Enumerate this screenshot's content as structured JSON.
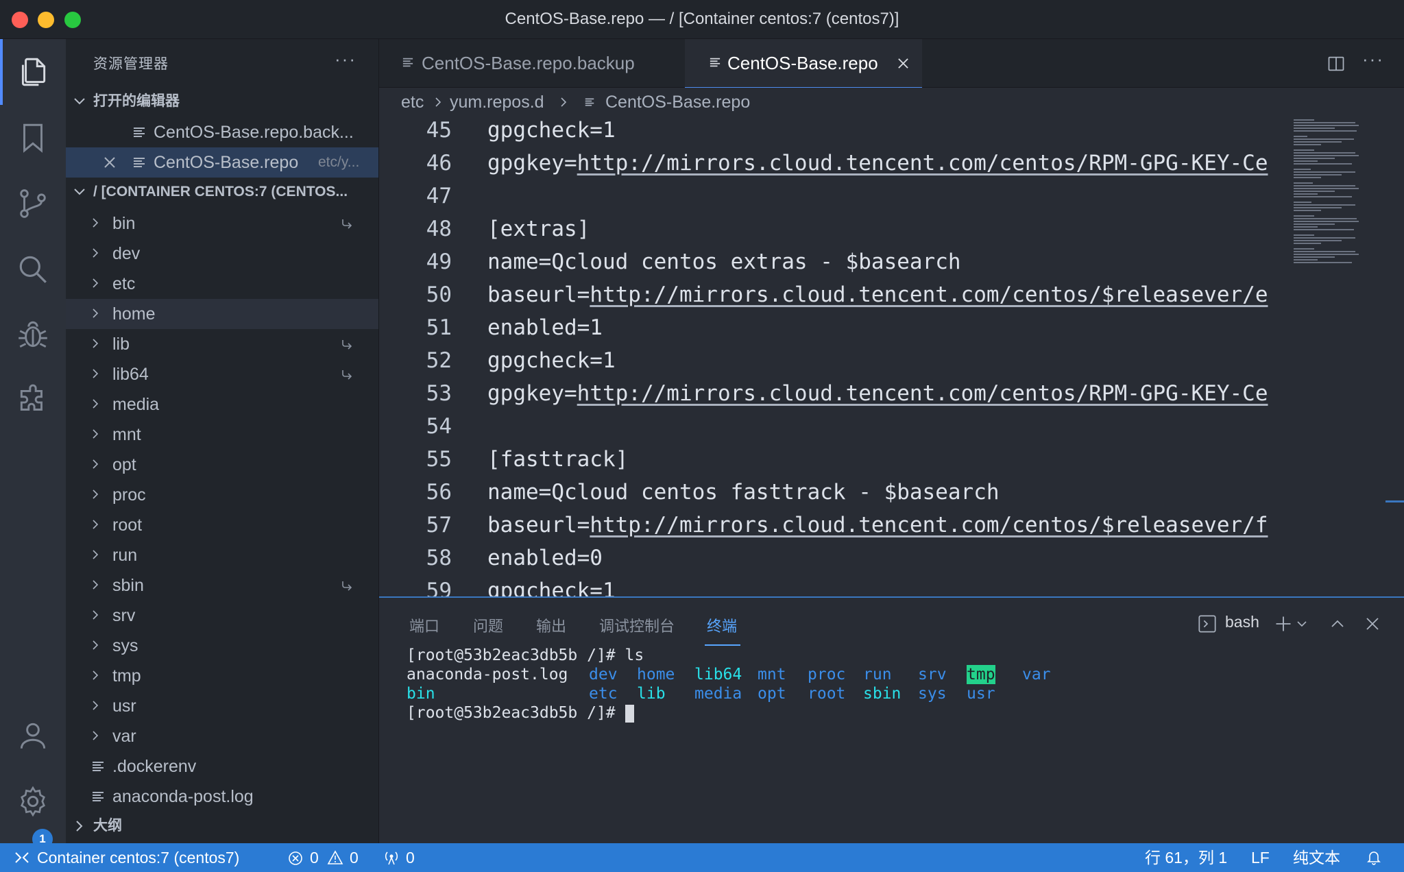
{
  "window": {
    "title": "CentOS-Base.repo — / [Container centos:7 (centos7)]",
    "traffic_colors": {
      "close": "#ff5f57",
      "minimize": "#febc2e",
      "zoom": "#28c840"
    }
  },
  "activity_bar": {
    "items": [
      "explorer-icon",
      "bookmark-icon",
      "source-control-icon",
      "search-icon",
      "debug-icon",
      "extensions-icon"
    ],
    "bottom": [
      "account-icon",
      "settings-icon"
    ],
    "settings_badge": "1"
  },
  "sidebar": {
    "title": "资源管理器",
    "more": "···",
    "open_editors": {
      "header": "打开的编辑器",
      "items": [
        {
          "name": "CentOS-Base.repo.back...",
          "path": ""
        },
        {
          "name": "CentOS-Base.repo",
          "path": "etc/y..."
        }
      ]
    },
    "root": {
      "header": "/ [CONTAINER CENTOS:7 (CENTOS...",
      "folders": [
        {
          "name": "bin",
          "symlink": true
        },
        {
          "name": "dev",
          "symlink": false
        },
        {
          "name": "etc",
          "symlink": false
        },
        {
          "name": "home",
          "symlink": false
        },
        {
          "name": "lib",
          "symlink": true
        },
        {
          "name": "lib64",
          "symlink": true
        },
        {
          "name": "media",
          "symlink": false
        },
        {
          "name": "mnt",
          "symlink": false
        },
        {
          "name": "opt",
          "symlink": false
        },
        {
          "name": "proc",
          "symlink": false
        },
        {
          "name": "root",
          "symlink": false
        },
        {
          "name": "run",
          "symlink": false
        },
        {
          "name": "sbin",
          "symlink": true
        },
        {
          "name": "srv",
          "symlink": false
        },
        {
          "name": "sys",
          "symlink": false
        },
        {
          "name": "tmp",
          "symlink": false
        },
        {
          "name": "usr",
          "symlink": false
        },
        {
          "name": "var",
          "symlink": false
        }
      ],
      "files": [
        ".dockerenv",
        "anaconda-post.log"
      ]
    },
    "outline_header": "大纲"
  },
  "editor": {
    "tabs": [
      {
        "label": "CentOS-Base.repo.backup",
        "active": false
      },
      {
        "label": "CentOS-Base.repo",
        "active": true
      }
    ],
    "breadcrumb": [
      "etc",
      "yum.repos.d",
      "CentOS-Base.repo"
    ],
    "lines": [
      {
        "n": "45",
        "pre": "gpgcheck=1",
        "url": ""
      },
      {
        "n": "46",
        "pre": "gpgkey=",
        "url": "http://mirrors.cloud.tencent.com/centos/RPM-GPG-KEY-Ce"
      },
      {
        "n": "47",
        "pre": "",
        "url": ""
      },
      {
        "n": "48",
        "pre": "[extras]",
        "url": ""
      },
      {
        "n": "49",
        "pre": "name=Qcloud centos extras - $basearch",
        "url": ""
      },
      {
        "n": "50",
        "pre": "baseurl=",
        "url": "http://mirrors.cloud.tencent.com/centos/$releasever/e"
      },
      {
        "n": "51",
        "pre": "enabled=1",
        "url": ""
      },
      {
        "n": "52",
        "pre": "gpgcheck=1",
        "url": ""
      },
      {
        "n": "53",
        "pre": "gpgkey=",
        "url": "http://mirrors.cloud.tencent.com/centos/RPM-GPG-KEY-Ce"
      },
      {
        "n": "54",
        "pre": "",
        "url": ""
      },
      {
        "n": "55",
        "pre": "[fasttrack]",
        "url": ""
      },
      {
        "n": "56",
        "pre": "name=Qcloud centos fasttrack - $basearch",
        "url": ""
      },
      {
        "n": "57",
        "pre": "baseurl=",
        "url": "http://mirrors.cloud.tencent.com/centos/$releasever/f"
      },
      {
        "n": "58",
        "pre": "enabled=0",
        "url": ""
      },
      {
        "n": "59",
        "pre": "gpgcheck=1",
        "url": ""
      }
    ]
  },
  "panel": {
    "tabs": [
      "端口",
      "问题",
      "输出",
      "调试控制台",
      "终端"
    ],
    "active_tab": "终端",
    "shell": "bash",
    "terminal": {
      "prompt1": "[root@53b2eac3db5b /]# ls",
      "row1": [
        {
          "t": "anaconda-post.log",
          "c": "plain"
        },
        {
          "t": "dev",
          "c": "dir"
        },
        {
          "t": "home",
          "c": "dir"
        },
        {
          "t": "lib64",
          "c": "link"
        },
        {
          "t": "mnt",
          "c": "dir"
        },
        {
          "t": "proc",
          "c": "dir"
        },
        {
          "t": "run",
          "c": "dir"
        },
        {
          "t": "srv",
          "c": "dir"
        },
        {
          "t": "tmp",
          "c": "sticky"
        },
        {
          "t": "var",
          "c": "dir"
        }
      ],
      "row2": [
        {
          "t": "bin",
          "c": "link"
        },
        {
          "t": "etc",
          "c": "dir"
        },
        {
          "t": "lib",
          "c": "link"
        },
        {
          "t": "media",
          "c": "dir"
        },
        {
          "t": "opt",
          "c": "dir"
        },
        {
          "t": "root",
          "c": "dir"
        },
        {
          "t": "sbin",
          "c": "link"
        },
        {
          "t": "sys",
          "c": "dir"
        },
        {
          "t": "usr",
          "c": "dir"
        }
      ],
      "prompt2": "[root@53b2eac3db5b /]# "
    }
  },
  "status_bar": {
    "remote": "Container centos:7 (centos7)",
    "errors": "0",
    "warnings": "0",
    "ports": "0",
    "cursor": "行 61，列 1",
    "eol": "LF",
    "language": "纯文本"
  },
  "colors": {
    "accent": "#2b7bd4",
    "dir": "#3b8eea",
    "link": "#29e0e8",
    "sticky_bg": "#23d18b"
  }
}
